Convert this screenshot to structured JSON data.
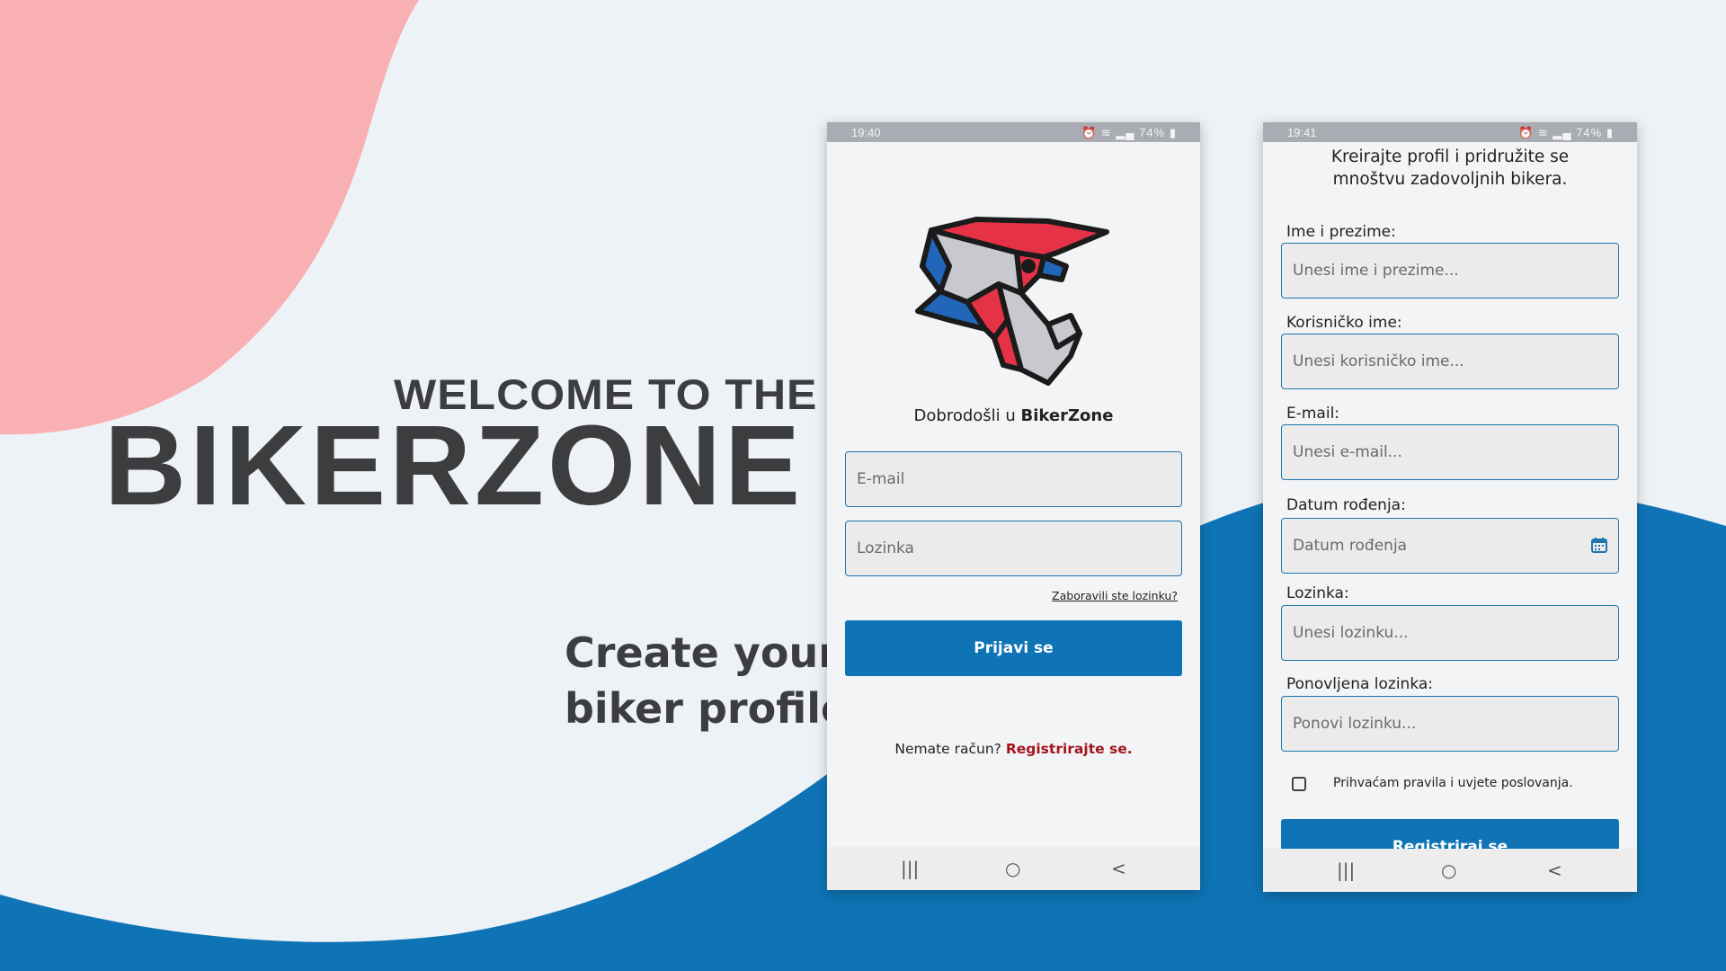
{
  "hero": {
    "welcome_line": "WELCOME TO THE",
    "brand": "BIKERZONE",
    "tagline_line1": "Create your",
    "tagline_line2": "biker profile"
  },
  "colors": {
    "background": "#edf2f6",
    "pink_blob": "#f9b0b3",
    "blue_wave": "#0e74b6",
    "text_dark": "#3d3d3f",
    "link_red": "#a3151b"
  },
  "login_screen": {
    "status": {
      "time": "19:40",
      "battery": "74%"
    },
    "logo_icon": "motocross-helmet-icon",
    "welcome_prefix": "Dobrodošli u ",
    "welcome_brand": "BikerZone",
    "email_placeholder": "E-mail",
    "password_placeholder": "Lozinka",
    "forgot_password": "Zaboravili ste lozinku?",
    "login_button": "Prijavi se",
    "no_account_text": "Nemate račun?",
    "register_link": "Registrirajte se."
  },
  "register_screen": {
    "status": {
      "time": "19:41",
      "battery": "74%"
    },
    "intro_line1": "Kreirajte profil i pridružite se",
    "intro_line2": "mnoštvu zadovoljnih bikera.",
    "fields": [
      {
        "label": "Ime i prezime:",
        "placeholder": "Unesi ime i prezime..."
      },
      {
        "label": "Korisničko ime:",
        "placeholder": "Unesi korisničko ime..."
      },
      {
        "label": "E-mail:",
        "placeholder": "Unesi e-mail..."
      },
      {
        "label": "Datum rođenja:",
        "placeholder": "Datum rođenja"
      },
      {
        "label": "Lozinka:",
        "placeholder": "Unesi lozinku..."
      },
      {
        "label": "Ponovljena lozinka:",
        "placeholder": "Ponovi lozinku..."
      }
    ],
    "accept_terms": "Prihvaćam pravila i uvjete poslovanja.",
    "accept_checked": false,
    "register_button": "Registriraj se"
  },
  "android_nav": {
    "recents": "|||",
    "home": "○",
    "back": "<"
  }
}
